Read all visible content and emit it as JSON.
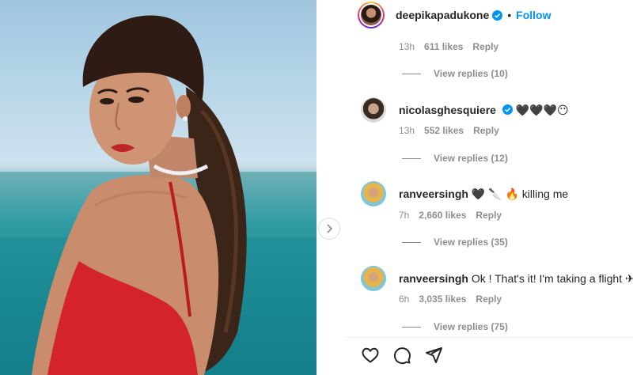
{
  "post": {
    "author": "deepikapadukone",
    "separator": "•",
    "follow_label": "Follow"
  },
  "top_thread": {
    "time": "13h",
    "likes": "611 likes",
    "reply": "Reply",
    "view_replies": "View replies (10)"
  },
  "comments": [
    {
      "user": "nicolasghesquiere",
      "verified": true,
      "text": "🖤🖤🖤😶",
      "time": "13h",
      "likes": "552 likes",
      "reply": "Reply",
      "view_replies": "View replies (12)"
    },
    {
      "user": "ranveersingh",
      "verified": false,
      "text": "🖤 🔪 🔥 killing me",
      "time": "7h",
      "likes": "2,660 likes",
      "reply": "Reply",
      "view_replies": "View replies (35)"
    },
    {
      "user": "ranveersingh",
      "verified": false,
      "text": "Ok ! That's it! I'm taking a flight ✈",
      "time": "6h",
      "likes": "3,035 likes",
      "reply": "Reply",
      "view_replies": "View replies (75)"
    }
  ],
  "colors": {
    "accent": "#0095f6",
    "muted": "#8e8e8e",
    "text": "#262626",
    "dress": "#d4242a"
  },
  "icons": {
    "like": "heart-icon",
    "comment": "comment-icon",
    "share": "paper-plane-icon",
    "next": "chevron-right-icon",
    "verified": "verified-badge-icon"
  }
}
